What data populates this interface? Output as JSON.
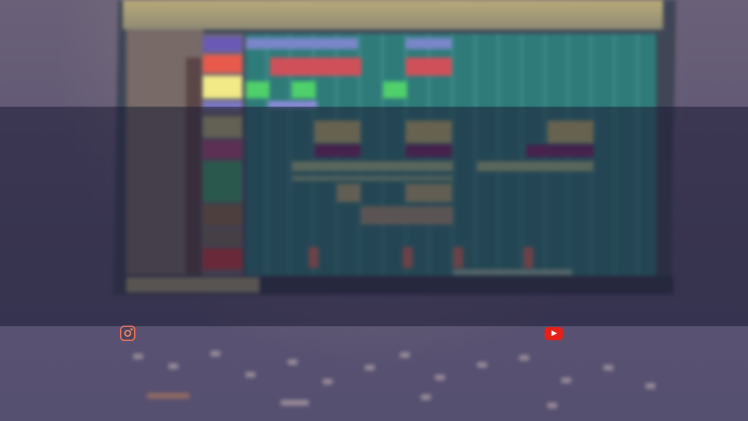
{
  "background": {
    "description_icon": "blurred-daw-monitor-photo",
    "overlay_color": "#1c1c34",
    "grid_color": "#2f7b7a"
  },
  "social": {
    "instagram": {
      "icon": "instagram-icon",
      "color": "#e9705a"
    },
    "youtube": {
      "icon": "youtube-icon",
      "color": "#e62117"
    }
  }
}
